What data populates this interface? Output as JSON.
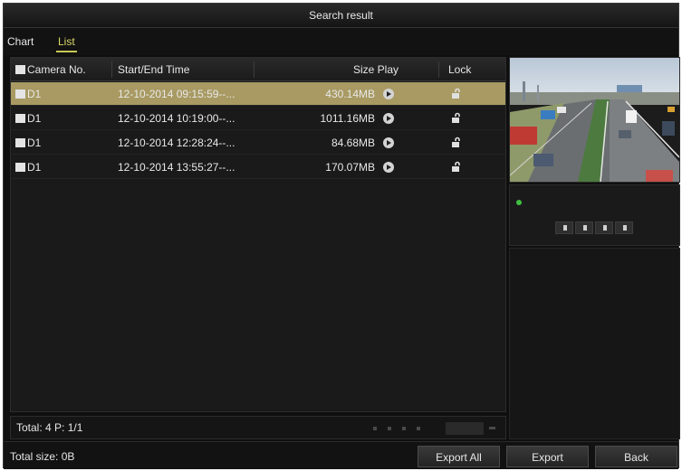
{
  "window": {
    "title": "Search result"
  },
  "tabs": [
    {
      "label": "Chart",
      "active": false
    },
    {
      "label": "List",
      "active": true
    }
  ],
  "table": {
    "columns": [
      "Camera No.",
      "Start/End Time",
      "Size Play",
      "Lock"
    ],
    "rows": [
      {
        "camera": "D1",
        "time": "12-10-2014 09:15:59--...",
        "size": "430.14MB",
        "locked": false,
        "selected": true
      },
      {
        "camera": "D1",
        "time": "12-10-2014 10:19:00--...",
        "size": "1011.16MB",
        "locked": false,
        "selected": false
      },
      {
        "camera": "D1",
        "time": "12-10-2014 12:28:24--...",
        "size": "84.68MB",
        "locked": false,
        "selected": false
      },
      {
        "camera": "D1",
        "time": "12-10-2014 13:55:27--...",
        "size": "170.07MB",
        "locked": false,
        "selected": false
      }
    ]
  },
  "status": {
    "total": "Total: 4  P: 1/1"
  },
  "footer": {
    "total_size": "Total size: 0B",
    "export_all_label": "Export All",
    "export_label": "Export",
    "back_label": "Back"
  },
  "colors": {
    "selected_row": "#a89a62",
    "tab_active": "#d9d96a",
    "indicator": "#40c040"
  }
}
